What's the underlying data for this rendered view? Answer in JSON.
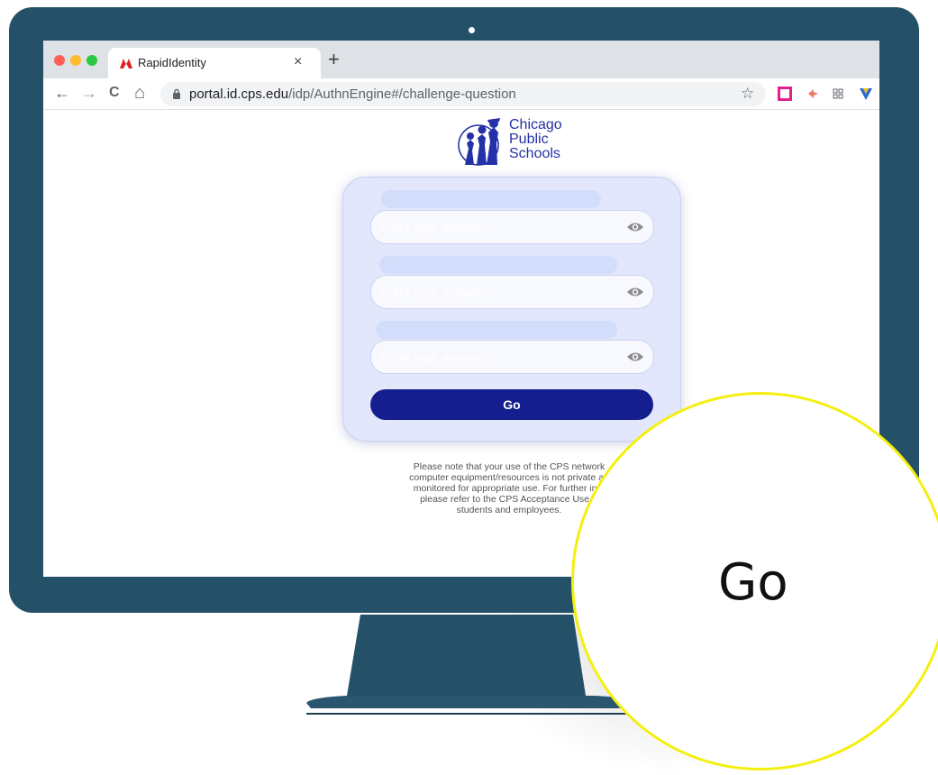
{
  "browser": {
    "tab_title": "RapidIdentity",
    "new_tab": "+",
    "tab_close": "×",
    "url_host": "portal.id.cps.edu",
    "url_path": "/idp/AuthnEngine#/challenge-question",
    "nav": {
      "back": "←",
      "forward": "→",
      "reload": "C",
      "home": "⌂"
    },
    "star": "☆"
  },
  "logo": {
    "line1": "Chicago",
    "line2": "Public",
    "line3": "Schools"
  },
  "form": {
    "placeholder_1": "Enter your answer",
    "placeholder_2": "Enter your answer",
    "placeholder_3": "Enter your answer",
    "go_label": "Go"
  },
  "notice": {
    "line1": "Please note that your use of the CPS network",
    "line2": "computer equipment/resources is not private an",
    "line3": "monitored for appropriate use. For further info",
    "line4": "please refer to the CPS Acceptance Use P",
    "line5": "students and employees."
  },
  "zoom": {
    "label": "Go"
  },
  "colors": {
    "bezel": "#245068",
    "button": "#151e8e",
    "card": "#e3e7fb",
    "callout_ring": "#f5ef10"
  },
  "icons": [
    "lock-icon",
    "star-icon",
    "eye-icon",
    "tab-logo-icon",
    "extension-icon"
  ]
}
